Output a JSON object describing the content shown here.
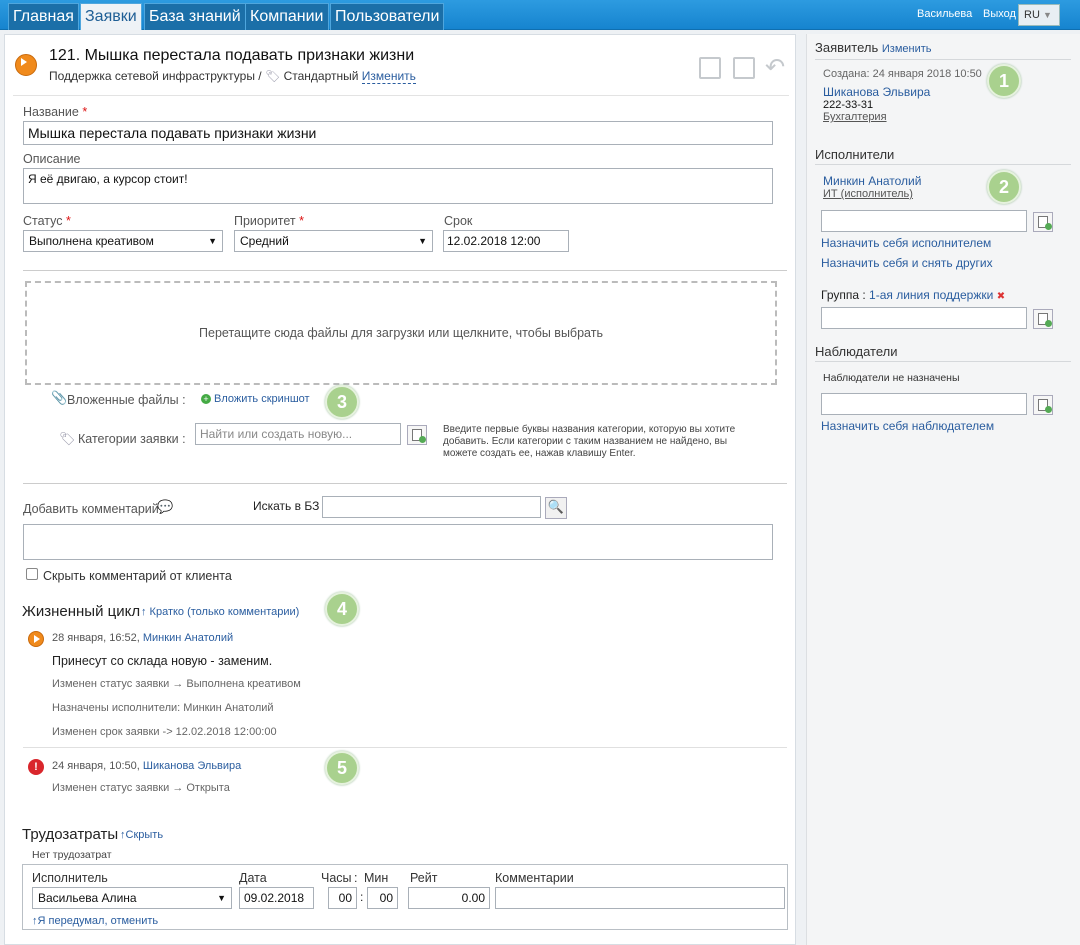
{
  "nav": {
    "tabs": [
      "Главная",
      "Заявки",
      "База знаний",
      "Компании",
      "Пользователи"
    ],
    "user": "Васильева",
    "logout": "Выход",
    "lang": "RU"
  },
  "ticket": {
    "title": "121. Мышка перестала подавать признаки жизни",
    "service": "Поддержка сетевой инфраструктуры /",
    "sla": "Стандартный",
    "change": "Изменить"
  },
  "form": {
    "name_label": "Название",
    "name_value": "Мышка перестала подавать признаки жизни",
    "desc_label": "Описание",
    "desc_value": "Я её двигаю, а курсор стоит!",
    "status_label": "Статус",
    "status_value": "Выполнена креативом",
    "priority_label": "Приоритет",
    "priority_value": "Средний",
    "due_label": "Срок",
    "due_value": "12.02.2018 12:00",
    "required_mark": "*",
    "dropzone": "Перетащите сюда файлы для загрузки или щелкните, чтобы выбрать",
    "attachments_label": "Вложенные файлы :",
    "attach_screenshot": "Вложить скриншот",
    "categories_label": "Категории заявки :",
    "categories_placeholder": "Найти или создать новую...",
    "categories_hint": "Введите первые буквы названия категории, которую вы хотите добавить. Если категории с таким названием не найдено, вы можете создать ее, нажав клавишу Enter.",
    "add_comment": "Добавить комментарий",
    "search_kb": "Искать в БЗ",
    "hide_comment": "Скрыть комментарий от клиента"
  },
  "lifecycle": {
    "title": "Жизненный цикл",
    "toggle": "↑ Кратко (только комментарии)",
    "entries": [
      {
        "date": "28 января, 16:52,",
        "author": "Минкин Анатолий",
        "comment": "Принесут со склада новую - заменим.",
        "changes": [
          "Изменен статус заявки → Выполнена креативом",
          "Назначены исполнители: Минкин Анатолий",
          "Изменен срок заявки -> 12.02.2018 12:00:00"
        ]
      },
      {
        "date": "24 января, 10:50,",
        "author": "Шиканова Эльвира",
        "comment": "",
        "changes": [
          "Изменен статус заявки → Открыта"
        ]
      }
    ]
  },
  "labor": {
    "title": "Трудозатраты",
    "toggle": "↑Скрыть",
    "none": "Нет трудозатрат",
    "col_executor": "Исполнитель",
    "col_date": "Дата",
    "col_hours": "Часы",
    "col_sep": ":",
    "col_min": "Мин",
    "col_rate": "Рейт",
    "col_comments": "Комментарии",
    "executor": "Васильева Алина",
    "date": "09.02.2018",
    "hours": "00",
    "minutes": "00",
    "rate": "0.00",
    "cancel": "↑Я передумал, отменить"
  },
  "side": {
    "applicant_head": "Заявитель",
    "applicant_change": "Изменить",
    "created": "Создана: 24 января 2018 10:50",
    "applicant_name": "Шиканова Эльвира",
    "applicant_phone": "222-33-31",
    "applicant_dept": "Бухгалтерия",
    "executors_head": "Исполнители",
    "executor_name": "Минкин Анатолий",
    "executor_role": "ИТ (исполнитель)",
    "assign_self": "Назначить себя исполнителем",
    "assign_self_remove": "Назначить себя и снять других",
    "group_label": "Группа :",
    "group_value": "1-ая линия поддержки",
    "group_remove": "✖",
    "observers_head": "Наблюдатели",
    "observers_none": "Наблюдатели не назначены",
    "assign_observer": "Назначить себя наблюдателем"
  },
  "badges": [
    "1",
    "2",
    "3",
    "4",
    "5"
  ]
}
